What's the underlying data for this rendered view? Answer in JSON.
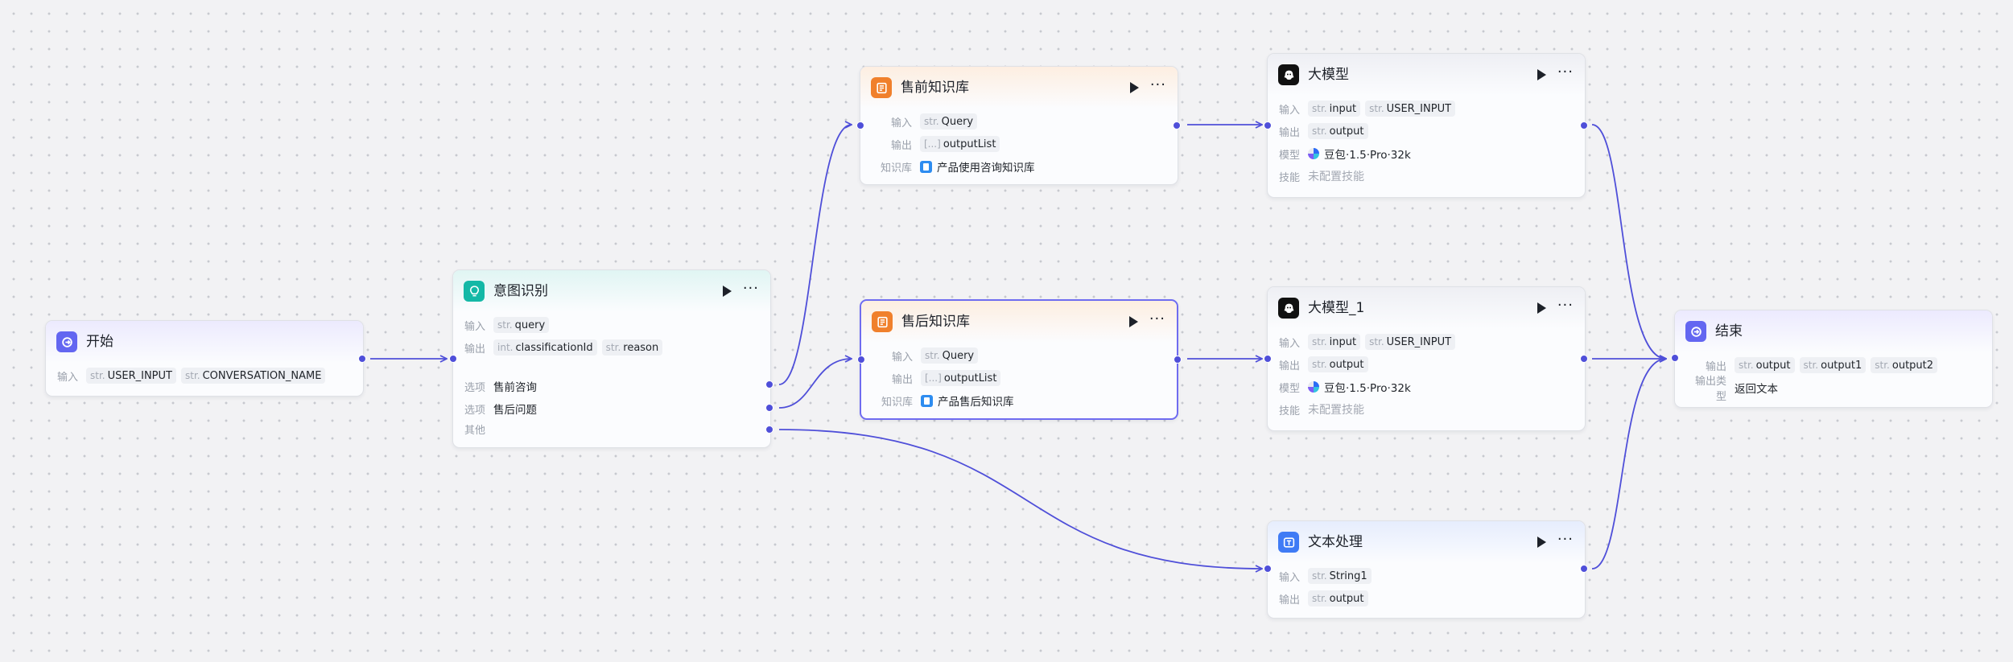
{
  "labels": {
    "input": "输入",
    "output": "输出",
    "option": "选项",
    "other": "其他",
    "kb": "知识库",
    "model": "模型",
    "skill": "技能",
    "output_type": "输出类型"
  },
  "start": {
    "title": "开始",
    "inputs": [
      {
        "type": "str.",
        "name": "USER_INPUT"
      },
      {
        "type": "str.",
        "name": "CONVERSATION_NAME"
      }
    ]
  },
  "intent": {
    "title": "意图识别",
    "inputs": [
      {
        "type": "str.",
        "name": "query"
      }
    ],
    "outputs": [
      {
        "type": "int.",
        "name": "classificationId"
      },
      {
        "type": "str.",
        "name": "reason"
      }
    ],
    "options": [
      "售前咨询",
      "售后问题"
    ]
  },
  "kb_pre": {
    "title": "售前知识库",
    "input": {
      "type": "str.",
      "name": "Query"
    },
    "output": {
      "type": "[...]",
      "name": "outputList"
    },
    "kb_name": "产品使用咨询知识库"
  },
  "kb_post": {
    "title": "售后知识库",
    "input": {
      "type": "str.",
      "name": "Query"
    },
    "output": {
      "type": "[...]",
      "name": "outputList"
    },
    "kb_name": "产品售后知识库"
  },
  "llm": {
    "title": "大模型",
    "inputs": [
      {
        "type": "str.",
        "name": "input"
      },
      {
        "type": "str.",
        "name": "USER_INPUT"
      }
    ],
    "output": {
      "type": "str.",
      "name": "output"
    },
    "model": "豆包·1.5·Pro·32k",
    "skill": "未配置技能"
  },
  "llm1": {
    "title": "大模型_1",
    "inputs": [
      {
        "type": "str.",
        "name": "input"
      },
      {
        "type": "str.",
        "name": "USER_INPUT"
      }
    ],
    "output": {
      "type": "str.",
      "name": "output"
    },
    "model": "豆包·1.5·Pro·32k",
    "skill": "未配置技能"
  },
  "text_proc": {
    "title": "文本处理",
    "input": {
      "type": "str.",
      "name": "String1"
    },
    "output": {
      "type": "str.",
      "name": "output"
    }
  },
  "end": {
    "title": "结束",
    "outputs": [
      {
        "type": "str.",
        "name": "output"
      },
      {
        "type": "str.",
        "name": "output1"
      },
      {
        "type": "str.",
        "name": "output2"
      }
    ],
    "output_type": "返回文本"
  },
  "colors": {
    "edge": "#4f4fd9",
    "selected_border": "#6f6cf0",
    "start_icon": "#6366f1",
    "intent_icon": "#14b8a6",
    "kb_icon": "#f0802c",
    "llm_icon": "#111111",
    "text_icon": "#3f7bf5",
    "end_icon": "#6366f1"
  },
  "icons": {
    "start": "start-icon",
    "intent": "lightbulb-icon",
    "kb": "knowledge-icon",
    "llm": "brain-icon",
    "text": "text-process-icon",
    "end": "end-icon"
  }
}
